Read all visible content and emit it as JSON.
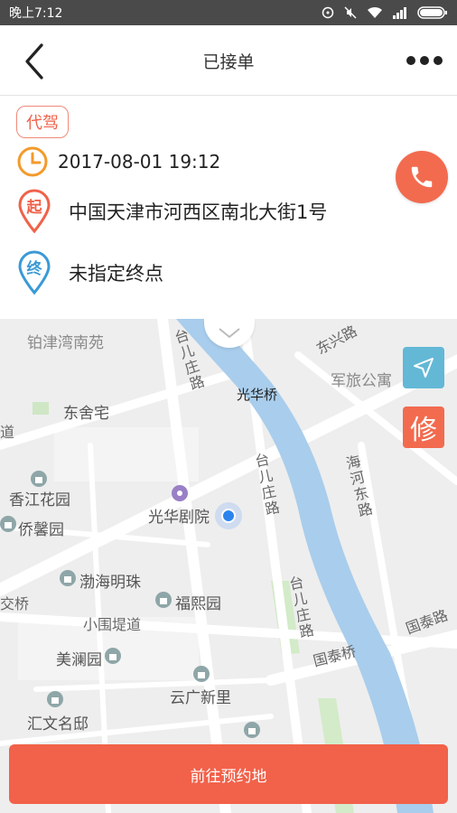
{
  "status_bar": {
    "time": "晚上7:12"
  },
  "header": {
    "title": "已接单"
  },
  "order": {
    "service_tag": "代驾",
    "time": "2017-08-01 19:12",
    "start_marker": "起",
    "start_address": "中国天津市河西区南北大街1号",
    "end_marker": "终",
    "end_address": "未指定终点"
  },
  "map": {
    "edit_label": "修",
    "labels": {
      "l1": "铂津湾南苑",
      "l2": "东舍宅",
      "l3": "香江花园",
      "l4": "侨馨园",
      "l5": "光华剧院",
      "l6": "渤海明珠",
      "l7": "福熙园",
      "l8": "小围堤道",
      "l9": "美澜园",
      "l10": "云广新里",
      "l11": "汇文名邸",
      "l12": "军旅公寓",
      "l13": "光华桥",
      "l14": "国泰桥",
      "l15": "国泰路",
      "l16": "台儿庄路",
      "l17": "台儿庄路",
      "l18": "台儿庄路",
      "l19": "东兴路",
      "l20": "海河东路",
      "l21": "道",
      "l22": "交桥"
    }
  },
  "footer": {
    "go_button": "前往预约地"
  },
  "colors": {
    "accent": "#f2614a",
    "river": "#a9cdec",
    "locate": "#63b8d6"
  }
}
